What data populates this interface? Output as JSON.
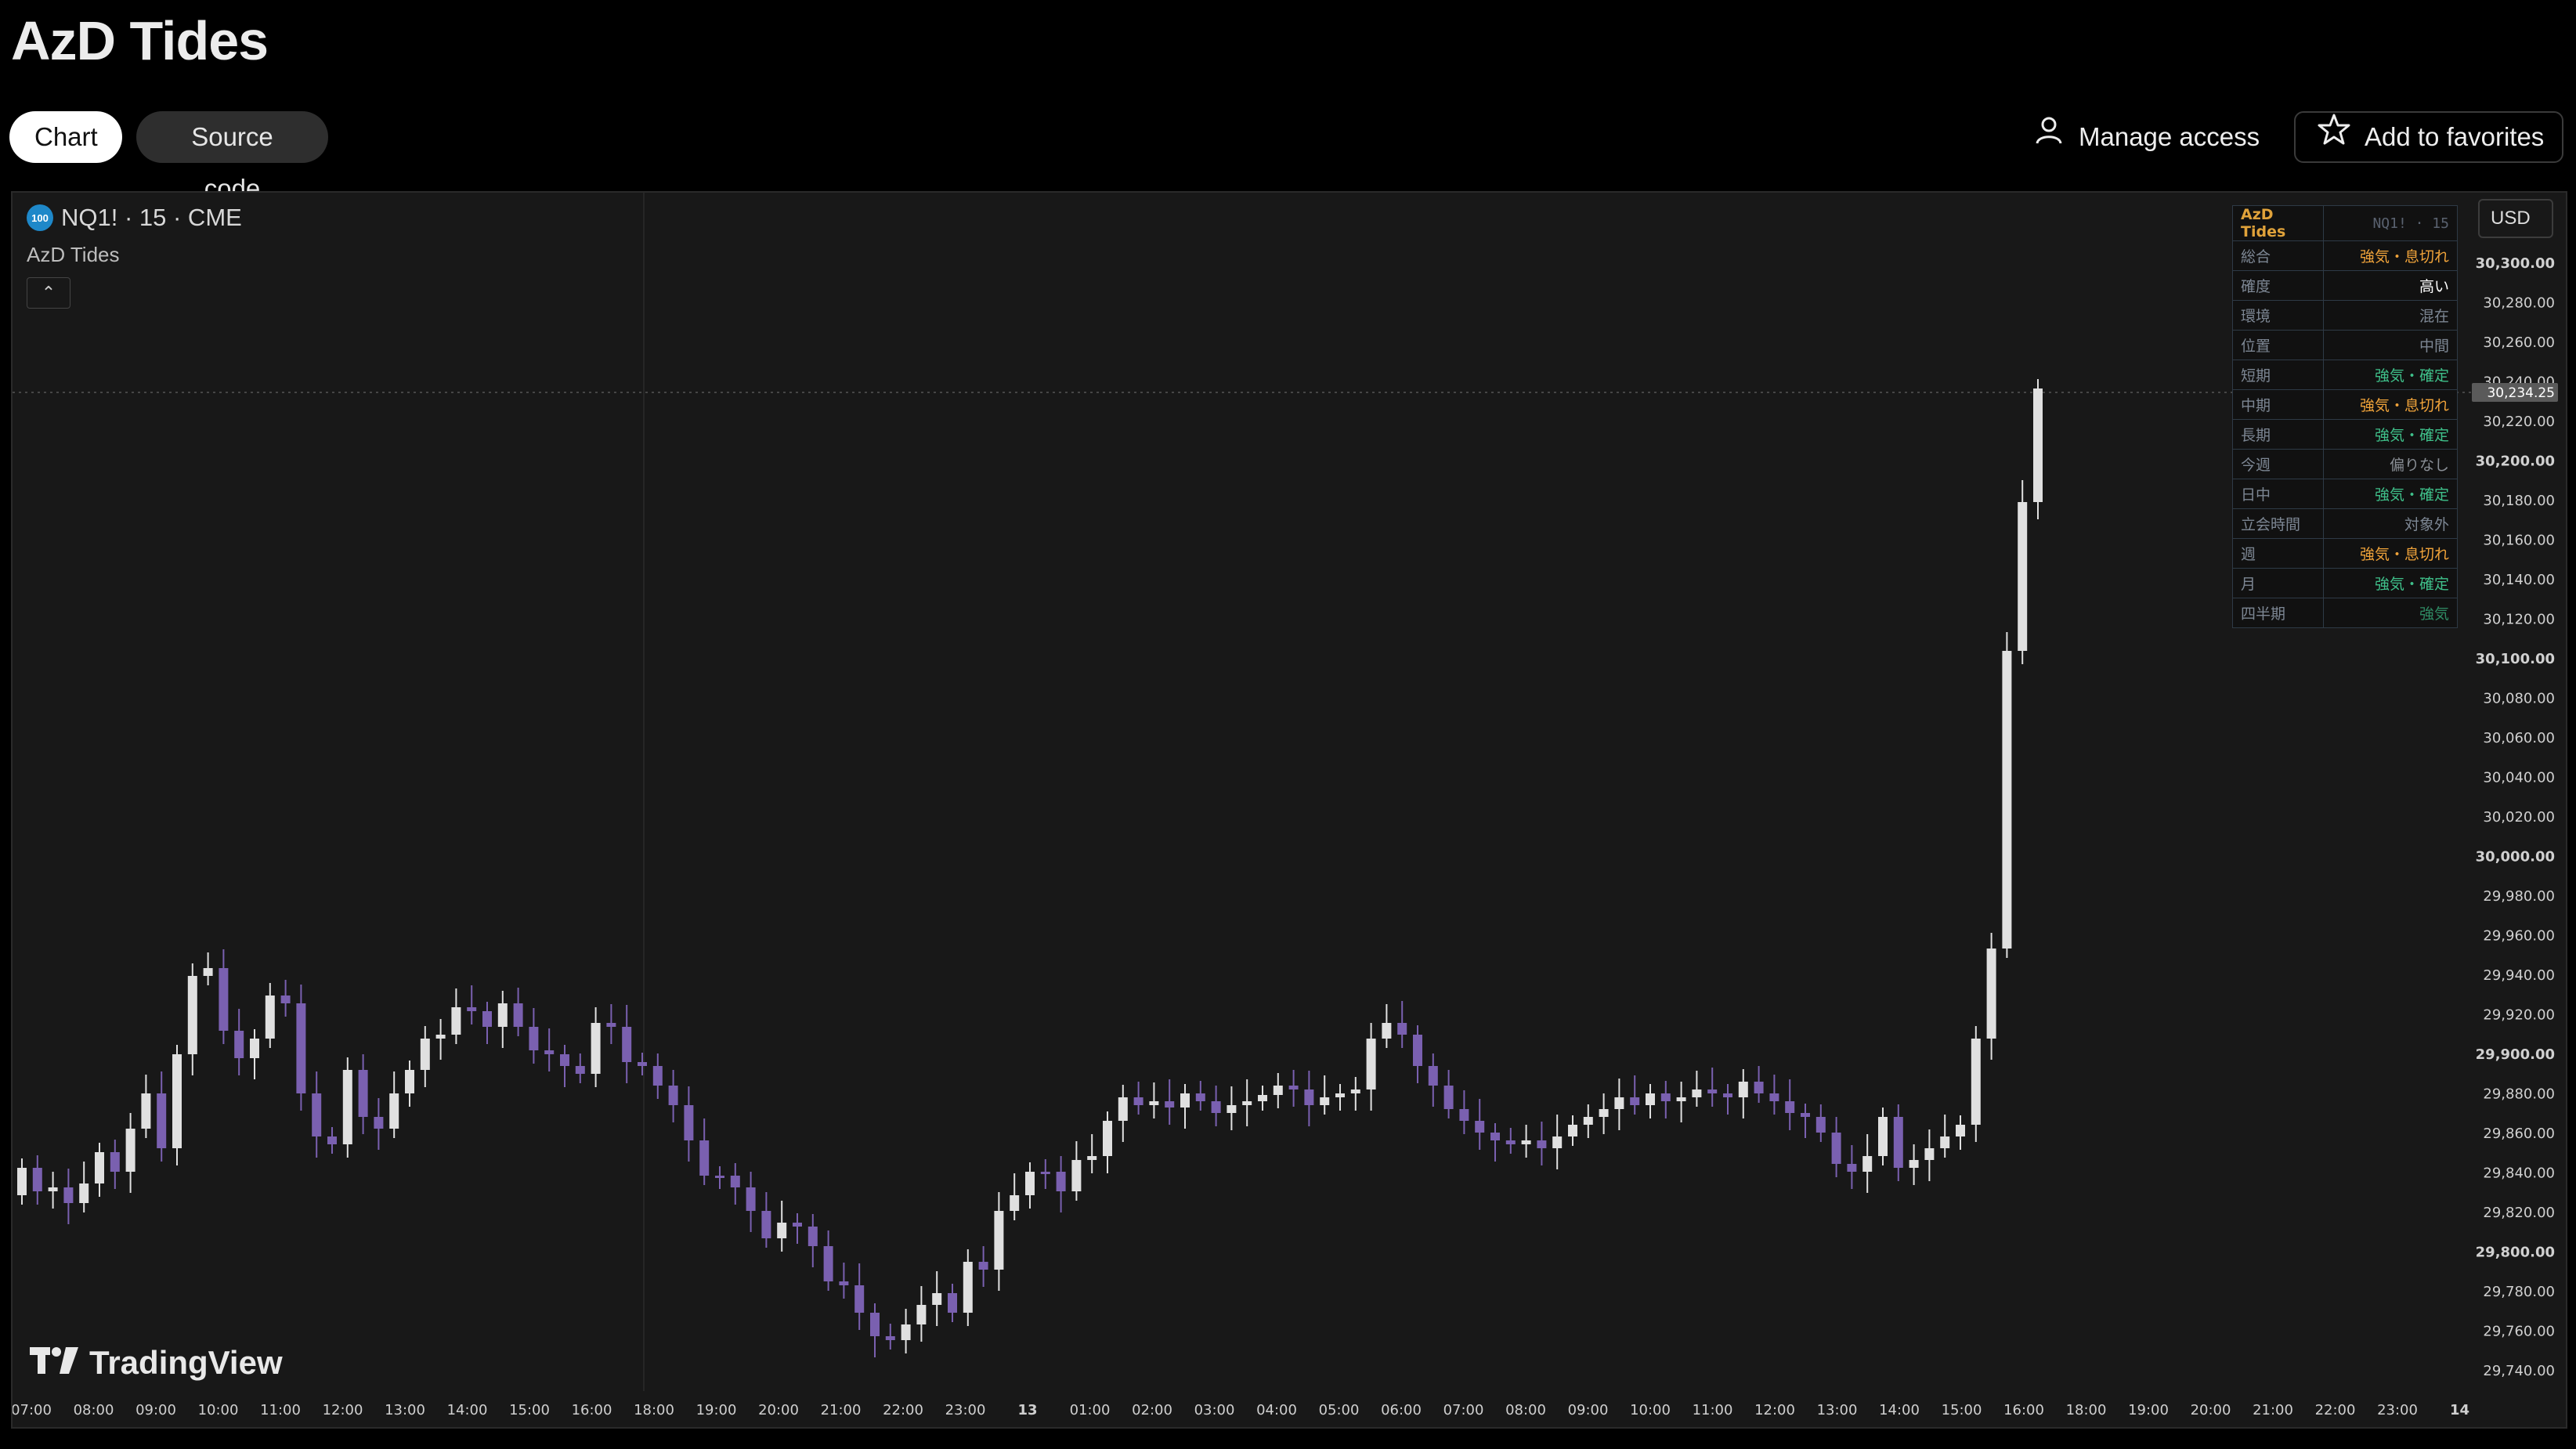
{
  "page": {
    "title": "AzD Tides",
    "tabs": [
      {
        "label": "Chart",
        "active": true
      },
      {
        "label": "Source code",
        "active": false
      }
    ],
    "actions": {
      "manage_access": "Manage access",
      "add_favorites": "Add to favorites"
    }
  },
  "chart": {
    "symbol_badge": "100",
    "symbol_line": "NQ1! · 15 · CME",
    "indicator_name": "AzD Tides",
    "currency": "USD",
    "last_price_label": "30,234.25",
    "watermark": "TradingView",
    "price_labels": [
      "30,300.00",
      "30,280.00",
      "30,260.00",
      "30,240.00",
      "30,220.00",
      "30,200.00",
      "30,180.00",
      "30,160.00",
      "30,140.00",
      "30,120.00",
      "30,100.00",
      "30,080.00",
      "30,060.00",
      "30,040.00",
      "30,020.00",
      "30,000.00",
      "29,980.00",
      "29,960.00",
      "29,940.00",
      "29,920.00",
      "29,900.00",
      "29,880.00",
      "29,860.00",
      "29,840.00",
      "29,820.00",
      "29,800.00",
      "29,780.00",
      "29,760.00",
      "29,740.00"
    ],
    "time_labels": [
      "07:00",
      "08:00",
      "09:00",
      "10:00",
      "11:00",
      "12:00",
      "13:00",
      "14:00",
      "15:00",
      "16:00",
      "18:00",
      "19:00",
      "20:00",
      "21:00",
      "22:00",
      "23:00",
      "13",
      "01:00",
      "02:00",
      "03:00",
      "04:00",
      "05:00",
      "06:00",
      "07:00",
      "08:00",
      "09:00",
      "10:00",
      "11:00",
      "12:00",
      "13:00",
      "14:00",
      "15:00",
      "16:00",
      "18:00",
      "19:00",
      "20:00",
      "21:00",
      "22:00",
      "23:00",
      "14"
    ],
    "colors": {
      "up": "#e0e0e0",
      "down": "#7a60b0",
      "background": "#181818"
    }
  },
  "info_table": {
    "header": {
      "label": "AzD Tides",
      "value": "NQ1! · 15"
    },
    "rows": [
      {
        "label": "総合",
        "value": "強気・息切れ",
        "color": "#f0a33a"
      },
      {
        "label": "確度",
        "value": "高い",
        "color": "#ffffff"
      },
      {
        "label": "環境",
        "value": "混在",
        "color": "#7d8794"
      },
      {
        "label": "位置",
        "value": "中間",
        "color": "#7d8794"
      },
      {
        "label": "短期",
        "value": "強気・確定",
        "color": "#3fc08a"
      },
      {
        "label": "中期",
        "value": "強気・息切れ",
        "color": "#f0a33a"
      },
      {
        "label": "長期",
        "value": "強気・確定",
        "color": "#3fc08a"
      },
      {
        "label": "今週",
        "value": "偏りなし",
        "color": "#8a8f96"
      },
      {
        "label": "日中",
        "value": "強気・確定",
        "color": "#3fc08a"
      },
      {
        "label": "立会時間",
        "value": "対象外",
        "color": "#7d8794"
      },
      {
        "label": "週",
        "value": "強気・息切れ",
        "color": "#f0a33a"
      },
      {
        "label": "月",
        "value": "強気・確定",
        "color": "#3fc08a"
      },
      {
        "label": "四半期",
        "value": "強気",
        "color": "#2f8a63"
      }
    ]
  }
}
